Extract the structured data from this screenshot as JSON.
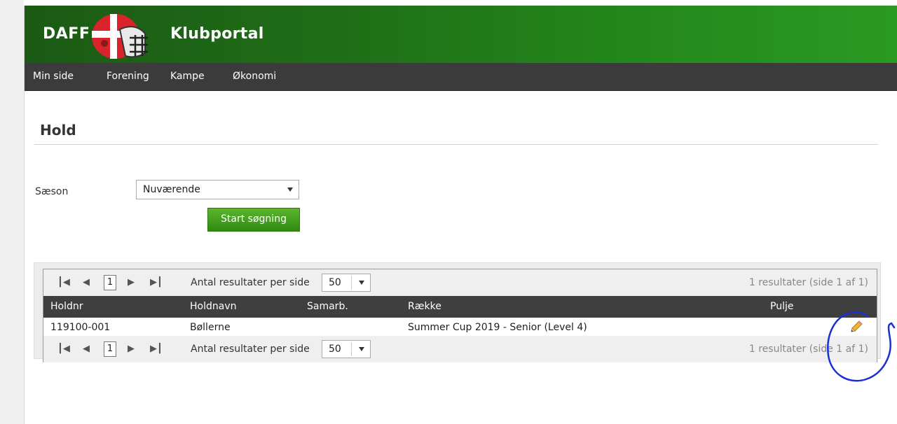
{
  "header": {
    "brand_left": "DAFF",
    "brand_right": "Klubportal",
    "colors": {
      "header_green": "#1f6d17",
      "nav_dark": "#3b3b3b",
      "button_green": "#3f9e1d"
    }
  },
  "nav": {
    "items": [
      {
        "label": "Min side"
      },
      {
        "label": "Forening"
      },
      {
        "label": "Kampe"
      },
      {
        "label": "Økonomi"
      }
    ]
  },
  "page": {
    "title": "Hold"
  },
  "filters": {
    "season_label": "Sæson",
    "season_value": "Nuværende",
    "search_button": "Start søgning"
  },
  "pager": {
    "first_icon": "first-page-icon",
    "prev_icon": "prev-page-icon",
    "next_icon": "next-page-icon",
    "last_icon": "last-page-icon",
    "current_page": "1",
    "page_size_label": "Antal resultater per side",
    "page_size_value": "50",
    "info": "1 resultater (side 1 af 1)"
  },
  "table": {
    "headers": {
      "holdnr": "Holdnr",
      "holdnavn": "Holdnavn",
      "samarb": "Samarb.",
      "raekke": "Række",
      "pulje": "Pulje"
    },
    "rows": [
      {
        "holdnr": "119100-001",
        "holdnavn": "Bøllerne",
        "samarb": "",
        "raekke": "Summer Cup 2019 - Senior (Level 4)",
        "pulje": "",
        "action_icon": "pencil-edit-icon"
      }
    ]
  }
}
